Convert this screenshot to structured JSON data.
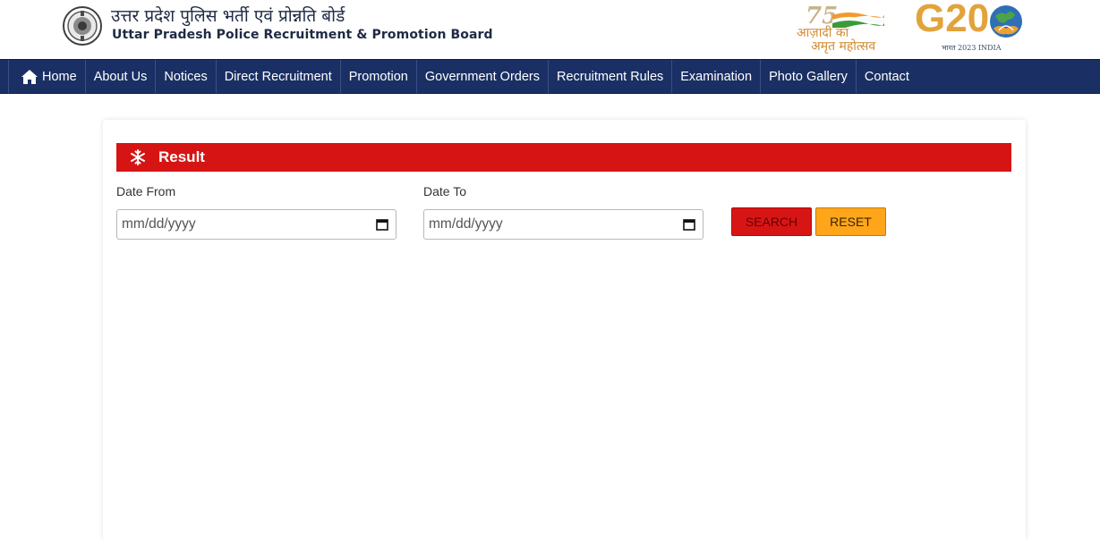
{
  "header": {
    "org_name_hindi": "उत्तर प्रदेश पुलिस भर्ती एवं प्रोन्नति बोर्ड",
    "org_name_english": "Uttar Pradesh Police Recruitment & Promotion Board",
    "azadi_number": "75",
    "azadi_line1": "आज़ादी का",
    "azadi_line2": "अमृत महोत्सव",
    "g20_text": "G20",
    "g20_subtitle": "भारत 2023 INDIA"
  },
  "nav": {
    "items": [
      {
        "label": "Home",
        "icon": "home-icon"
      },
      {
        "label": "About Us"
      },
      {
        "label": "Notices"
      },
      {
        "label": "Direct Recruitment"
      },
      {
        "label": "Promotion"
      },
      {
        "label": "Government Orders"
      },
      {
        "label": "Recruitment Rules"
      },
      {
        "label": "Examination"
      },
      {
        "label": "Photo Gallery"
      },
      {
        "label": "Contact"
      }
    ]
  },
  "result": {
    "title": "Result",
    "icon": "snowflake-icon"
  },
  "filters": {
    "date_from_label": "Date From",
    "date_from_value": "mm/dd/yyyy",
    "date_to_label": "Date To",
    "date_to_value": "mm/dd/yyyy",
    "search_label": "SEARCH",
    "reset_label": "RESET"
  },
  "colors": {
    "nav_bg": "#1a2f63",
    "result_bar": "#d61414",
    "search_btn": "#d81515",
    "reset_btn": "#ffa51a"
  }
}
